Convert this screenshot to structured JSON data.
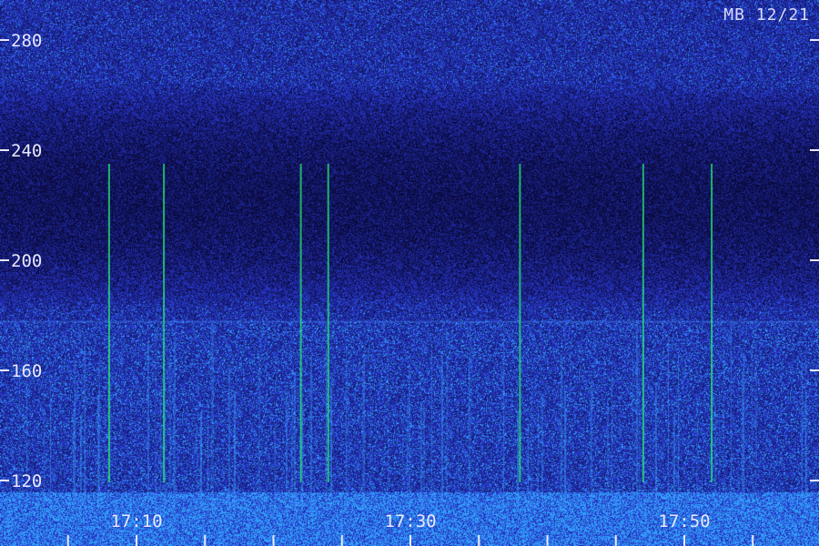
{
  "corner_label": "MB 12/21",
  "chart_data": {
    "type": "heatmap",
    "title": "",
    "xlabel": "",
    "ylabel": "",
    "y_ticks": [
      "280",
      "240",
      "200",
      "160",
      "120"
    ],
    "x_ticks": [
      "17:10",
      "17:30",
      "17:50"
    ],
    "ylim": [
      106,
      292
    ],
    "colors": {
      "background": "#12128a",
      "signal": "#2a9cff",
      "hot": "#27e86e",
      "text": "#e8e8ff"
    },
    "strong_events_time": [
      "17:08",
      "17:12",
      "17:22",
      "17:24",
      "17:38",
      "17:47",
      "17:52"
    ],
    "band_edge": 178
  }
}
